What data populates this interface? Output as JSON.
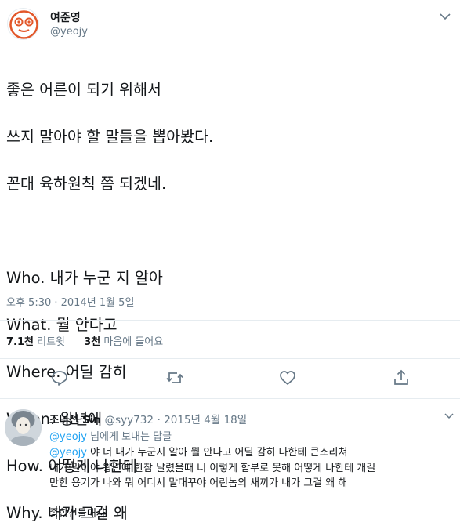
{
  "tweet": {
    "display_name": "여준영",
    "handle": "@yeojy",
    "lines": [
      "좋은 어른이 되기 위해서",
      "쓰지 말아야 할 말들을 뽑아봤다.",
      "꼰대 육하원칙 쯤 되겠네.",
      "",
      "Who. 내가 누군 지 알아",
      "What. 뭘 안다고",
      "Where. 어딜 감히",
      "When. 왕년에",
      "How. 어떻게 나한테",
      "Why. 내가 그걸 왜"
    ],
    "timestamp": "오후 5:30 · 2014년 1월 5일",
    "stats": {
      "retweets_count": "7.1천",
      "retweets_label": "리트윗",
      "likes_count": "3천",
      "likes_label": "마음에 들어요"
    },
    "actions": {
      "reply_icon": "reply-icon",
      "retweet_icon": "retweet-icon",
      "like_icon": "heart-icon",
      "share_icon": "share-icon"
    }
  },
  "reply": {
    "display_name": "조너선 Sin",
    "handle": "@syy732",
    "date": "2015년 4월 18일",
    "reply_to_mention": "@yeojy",
    "reply_to_suffix": " 님에게 보내는 답글",
    "line1_mention": "@yeojy",
    "line1_text": " 야 너 내가 누군지 알아 뭘 안다고 어딜 감히 나한테 큰소리쳐",
    "line2": "내가 말이야 왕년에 한참 날렸을때 너 이렇게 함부로 못해 어떻게 나한테 개길",
    "line3": "만한 용기가 나와 뭐 어디서 말대꾸야 어린놈의 새끼가 내가 그걸 왜 해",
    "line4": "",
    "line5": "종합선물대사"
  },
  "colors": {
    "text": "#14171a",
    "muted": "#657786",
    "link": "#1da1f2",
    "divider": "#e6ecf0"
  }
}
